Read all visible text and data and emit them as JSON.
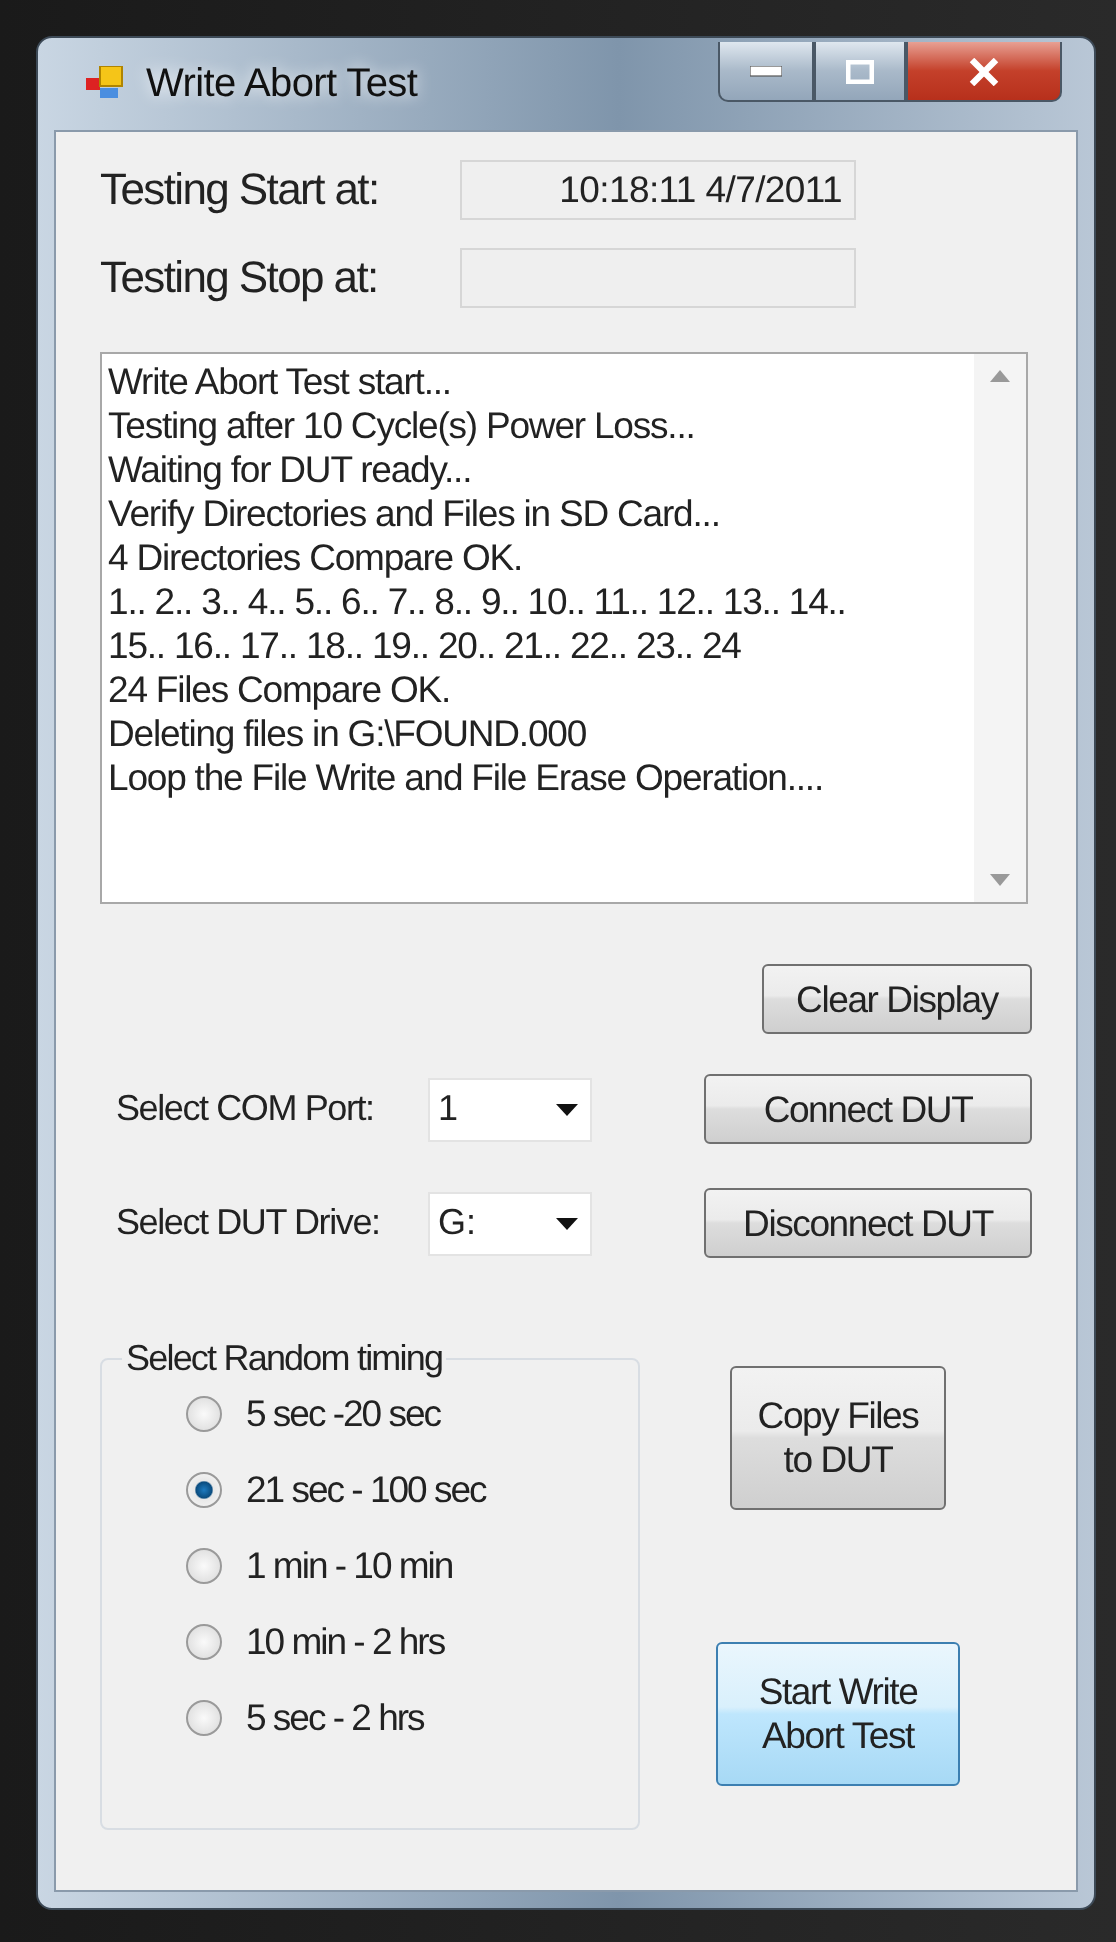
{
  "window": {
    "title": "Write Abort Test"
  },
  "start_time": {
    "label": "Testing Start at:",
    "value": "10:18:11 4/7/2011"
  },
  "stop_time": {
    "label": "Testing Stop at:"
  },
  "log": [
    "Write Abort Test start...",
    "Testing after 10 Cycle(s) Power Loss...",
    "Waiting for DUT ready...",
    "Verify Directories and Files in SD Card...",
    "4 Directories Compare OK.",
    "1.. 2.. 3.. 4.. 5.. 6.. 7.. 8.. 9.. 10.. 11.. 12.. 13.. 14..",
    "15.. 16.. 17.. 18.. 19.. 20.. 21.. 22.. 23.. 24",
    "24 Files Compare OK.",
    "Deleting files in G:\\FOUND.000",
    "Loop the File Write and File Erase Operation...."
  ],
  "clear_button": {
    "label": "Clear Display",
    "highlighted": false
  },
  "com_port": {
    "label": "Select COM Port:",
    "value": "1"
  },
  "connect_button": {
    "label": "Connect DUT",
    "highlighted": false
  },
  "dut_drive": {
    "label": "Select DUT Drive:",
    "value": "G:"
  },
  "disconnect_button": {
    "label": "Disconnect DUT",
    "highlighted": false
  },
  "timing": {
    "title": "Select Random timing",
    "options": [
      {
        "label": "5 sec -20 sec",
        "selected": false
      },
      {
        "label": "21 sec - 100 sec",
        "selected": true
      },
      {
        "label": "1 min - 10 min",
        "selected": false
      },
      {
        "label": "10 min - 2 hrs",
        "selected": false
      },
      {
        "label": "5 sec - 2 hrs",
        "selected": false
      }
    ]
  },
  "copy_button": {
    "label": "Copy Files to DUT",
    "highlighted": false
  },
  "start_button": {
    "label": "Start Write Abort Test",
    "highlighted": true
  }
}
